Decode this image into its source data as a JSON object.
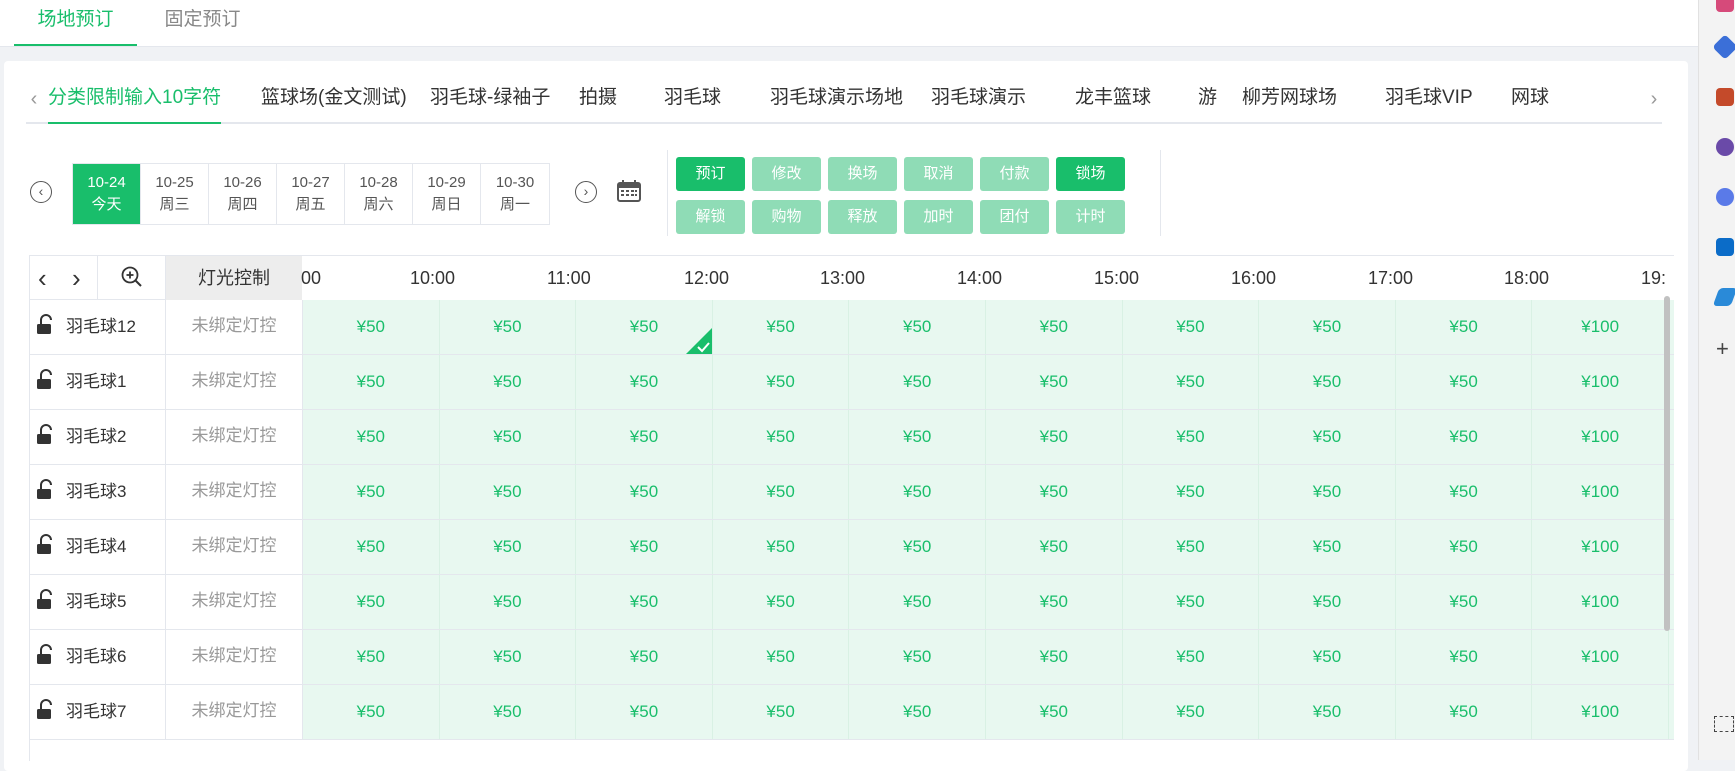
{
  "top_tabs": [
    {
      "label": "场地预订",
      "active": true
    },
    {
      "label": "固定预订",
      "active": false
    }
  ],
  "category_tabs": [
    {
      "label": "分类限制输入10字符",
      "active": true
    },
    {
      "label": "篮球场(金文测试)"
    },
    {
      "label": "羽毛球-绿袖子"
    },
    {
      "label": "拍摄"
    },
    {
      "label": "羽毛球"
    },
    {
      "label": "羽毛球演示场地"
    },
    {
      "label": "羽毛球演示"
    },
    {
      "label": "龙丰篮球"
    },
    {
      "label": "游"
    },
    {
      "label": "柳芳网球场"
    },
    {
      "label": "羽毛球VIP"
    },
    {
      "label": "网球"
    }
  ],
  "dates": [
    {
      "date": "10-24",
      "day": "今天",
      "active": true
    },
    {
      "date": "10-25",
      "day": "周三"
    },
    {
      "date": "10-26",
      "day": "周四"
    },
    {
      "date": "10-27",
      "day": "周五"
    },
    {
      "date": "10-28",
      "day": "周六"
    },
    {
      "date": "10-29",
      "day": "周日"
    },
    {
      "date": "10-30",
      "day": "周一"
    }
  ],
  "actions_row1": [
    {
      "label": "预订",
      "enabled": true
    },
    {
      "label": "修改",
      "enabled": false
    },
    {
      "label": "换场",
      "enabled": false
    },
    {
      "label": "取消",
      "enabled": false
    },
    {
      "label": "付款",
      "enabled": false
    },
    {
      "label": "锁场",
      "enabled": true
    }
  ],
  "actions_row2": [
    {
      "label": "解锁",
      "enabled": false
    },
    {
      "label": "购物",
      "enabled": false
    },
    {
      "label": "释放",
      "enabled": false
    },
    {
      "label": "加时",
      "enabled": false
    },
    {
      "label": "团付",
      "enabled": false
    },
    {
      "label": "计时",
      "enabled": false
    }
  ],
  "grid": {
    "light_header": "灯光控制",
    "times": [
      "00",
      "10:00",
      "11:00",
      "12:00",
      "13:00",
      "14:00",
      "15:00",
      "16:00",
      "17:00",
      "18:00",
      "19:"
    ],
    "light_status": "未绑定灯控",
    "prices": [
      "¥50",
      "¥50",
      "¥50",
      "¥50",
      "¥50",
      "¥50",
      "¥50",
      "¥50",
      "¥50",
      "¥100"
    ],
    "courts": [
      "羽毛球12",
      "羽毛球1",
      "羽毛球2",
      "羽毛球3",
      "羽毛球4",
      "羽毛球5",
      "羽毛球6",
      "羽毛球7"
    ],
    "selected": {
      "row": 0,
      "col": 2
    }
  },
  "colors": {
    "accent": "#19be6b",
    "accent_light": "#8fdcb6",
    "slot_bg": "#e8f8f0"
  }
}
